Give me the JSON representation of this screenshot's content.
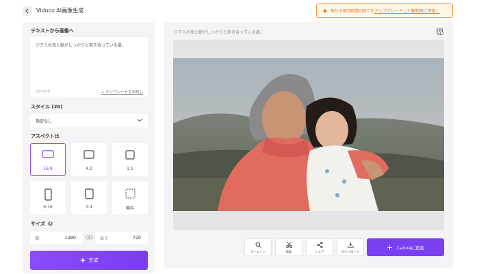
{
  "header": {
    "title": "Vidnoz AI画像生成",
    "upgrade_text": "残りの使用回数0回です",
    "upgrade_link": "アップグレードして無制限に使用！"
  },
  "left": {
    "prompt_label": "テキストから画像へ",
    "prompt_text": "ジア人の母と娘がしっかりと抱き合っている姿。",
    "prompt_count": "22/1000",
    "template_link": "+ テンプレートでお試し",
    "style_label": "スタイル (20)",
    "style_value": "指定なし",
    "aspect_label": "アスペクト比",
    "ratios": [
      {
        "label": "16:9",
        "selected": true
      },
      {
        "label": "4:3",
        "selected": false
      },
      {
        "label": "1:1",
        "selected": false
      },
      {
        "label": "9:16",
        "selected": false
      },
      {
        "label": "3:4",
        "selected": false
      },
      {
        "label": "無料",
        "selected": false
      }
    ],
    "size_label": "サイズ",
    "width_label": "幅",
    "width_value": "1280",
    "height_label": "高さ",
    "height_value": "720",
    "generate_label": "生成"
  },
  "right": {
    "caption": "ジア人の母と娘がしっかりと抱き合っている姿。",
    "tools": [
      {
        "label": "ズームイン",
        "icon": "search-icon"
      },
      {
        "label": "編集",
        "icon": "scissors-icon"
      },
      {
        "label": "シェア",
        "icon": "share-icon"
      },
      {
        "label": "ダウンロード",
        "icon": "download-icon"
      }
    ],
    "canva_label": "Canvaに追加"
  },
  "colors": {
    "accent": "#7b3ff2",
    "warning": "#f3a24a"
  }
}
